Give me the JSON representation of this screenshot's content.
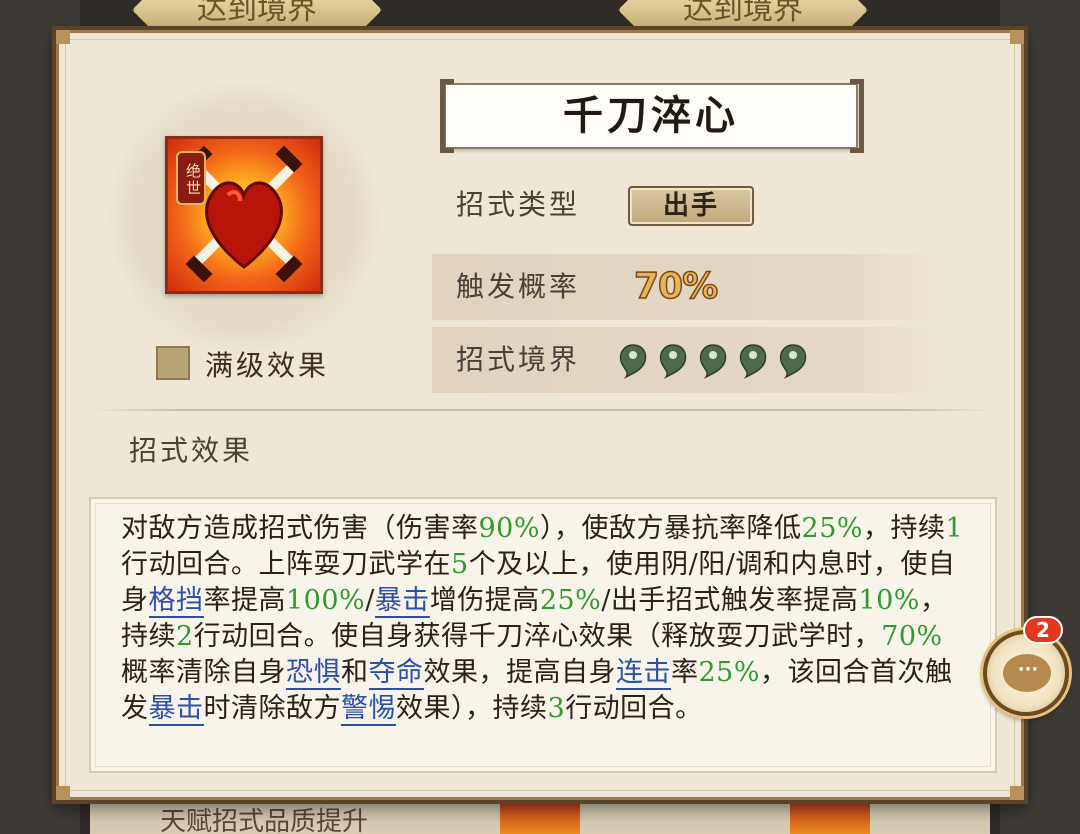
{
  "background": {
    "banner_left": "达到境界",
    "banner_right": "达到境界",
    "bottom_label": "天赋招式品质提升"
  },
  "skill": {
    "name": "千刀淬心",
    "rank_badge": "绝世",
    "max_level_label": "满级效果",
    "type_label": "招式类型",
    "type_value": "出手",
    "prob_label": "触发概率",
    "prob_value": "70%",
    "realm_label": "招式境界",
    "realm_level": 5,
    "realm_icon": "jade-droplet-icon",
    "effect_heading": "招式效果"
  },
  "effect_segments": [
    {
      "t": "对敌方造成招式伤害（伤害率"
    },
    {
      "t": "90%",
      "s": "num"
    },
    {
      "t": "），使敌方暴抗率降低"
    },
    {
      "t": "25%",
      "s": "num"
    },
    {
      "t": "，持续"
    },
    {
      "t": "1",
      "s": "num"
    },
    {
      "t": "行动回合。上阵耍刀武学在"
    },
    {
      "t": "5",
      "s": "num"
    },
    {
      "t": "个及以上，使用阴/阳/调和内息时，使自身"
    },
    {
      "t": "格挡",
      "s": "kw"
    },
    {
      "t": "率提高"
    },
    {
      "t": "100%",
      "s": "num"
    },
    {
      "t": "/"
    },
    {
      "t": "暴击",
      "s": "kw"
    },
    {
      "t": "增伤提高"
    },
    {
      "t": "25%",
      "s": "num"
    },
    {
      "t": "/出手招式触发率提高"
    },
    {
      "t": "10%",
      "s": "num"
    },
    {
      "t": "，持续"
    },
    {
      "t": "2",
      "s": "num"
    },
    {
      "t": "行动回合。使自身获得千刀淬心效果（释放耍刀武学时，"
    },
    {
      "t": "70%",
      "s": "num"
    },
    {
      "t": "概率清除自身"
    },
    {
      "t": "恐惧",
      "s": "kw"
    },
    {
      "t": "和"
    },
    {
      "t": "夺命",
      "s": "kw"
    },
    {
      "t": "效果，提高自身"
    },
    {
      "t": "连击",
      "s": "kw"
    },
    {
      "t": "率"
    },
    {
      "t": "25%",
      "s": "num"
    },
    {
      "t": "，该回合首次触发"
    },
    {
      "t": "暴击",
      "s": "kw"
    },
    {
      "t": "时清除敌方"
    },
    {
      "t": "警惕",
      "s": "kw"
    },
    {
      "t": "效果），持续"
    },
    {
      "t": "3",
      "s": "num"
    },
    {
      "t": "行动回合。"
    }
  ],
  "chat": {
    "icon": "chat-bubble-icon",
    "badge_count": "2",
    "dots": "···"
  },
  "colors": {
    "highlight_number": "#2f9b2f",
    "keyword_link": "#2c4fa8",
    "panel_bg": "#efe7d6"
  }
}
